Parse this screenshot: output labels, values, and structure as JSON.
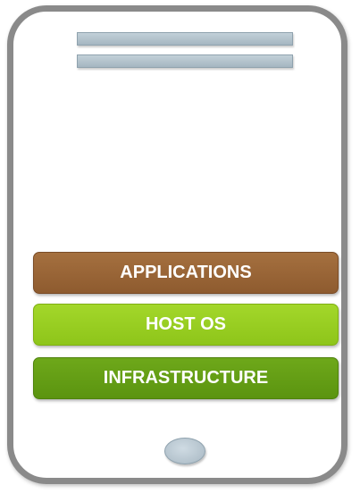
{
  "layers": {
    "applications": {
      "label": "APPLICATIONS",
      "color": "#99643a"
    },
    "host_os": {
      "label": "HOST OS",
      "color": "#97cd22"
    },
    "infrastructure": {
      "label": "INFRASTRUCTURE",
      "color": "#659e14"
    }
  },
  "device": {
    "frame_color": "#8a8a8a",
    "speaker_color": "#b3c2cc",
    "home_button_color": "#bccbd4"
  }
}
